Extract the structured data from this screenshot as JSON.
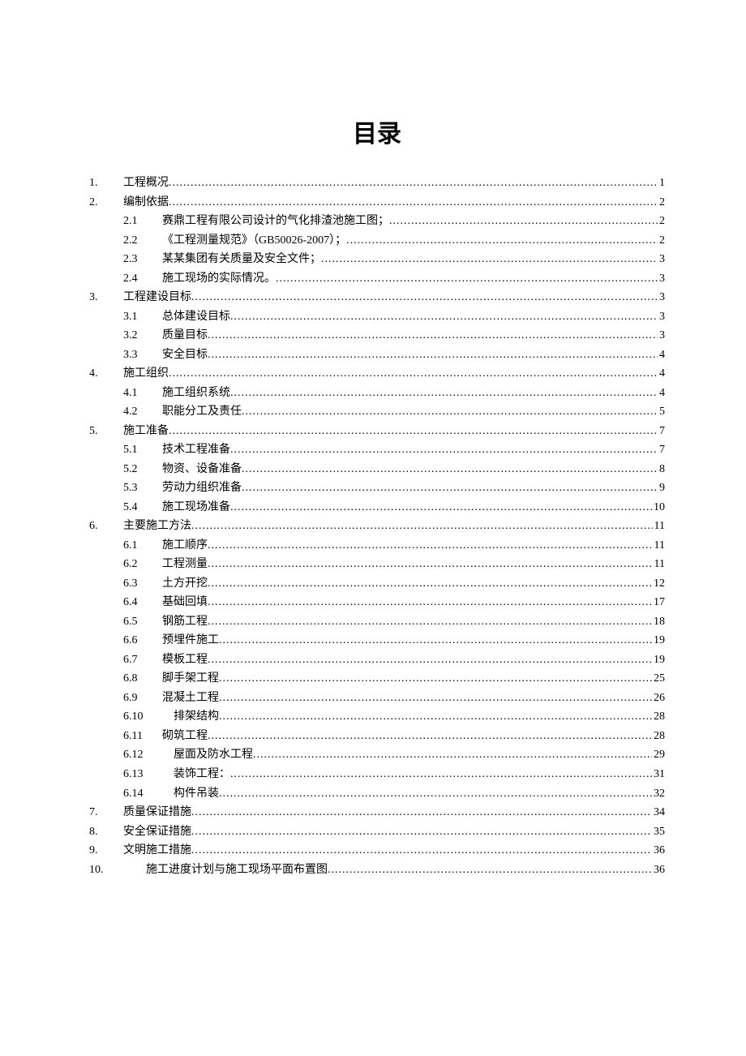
{
  "title": "目录",
  "toc": [
    {
      "level": 1,
      "num": "1.",
      "label": "工程概况",
      "page": "1"
    },
    {
      "level": 1,
      "num": "2.",
      "label": "编制依据",
      "page": "2"
    },
    {
      "level": 2,
      "num": "2.1",
      "label": "赛鼎工程有限公司设计的气化排渣池施工图；",
      "page": "2"
    },
    {
      "level": 2,
      "num": "2.2",
      "label": "《工程测量规范》（GB50026-2007）；",
      "page": "2"
    },
    {
      "level": 2,
      "num": "2.3",
      "label": "某某集团有关质量及安全文件；",
      "page": "3"
    },
    {
      "level": 2,
      "num": "2.4",
      "label": "施工现场的实际情况。",
      "page": "3"
    },
    {
      "level": 1,
      "num": "3.",
      "label": "工程建设目标",
      "page": "3"
    },
    {
      "level": 2,
      "num": "3.1",
      "label": "总体建设目标",
      "page": "3"
    },
    {
      "level": 2,
      "num": "3.2",
      "label": "质量目标",
      "page": "3"
    },
    {
      "level": 2,
      "num": "3.3",
      "label": "安全目标",
      "page": "4"
    },
    {
      "level": 1,
      "num": "4.",
      "label": "施工组织",
      "page": "4"
    },
    {
      "level": 2,
      "num": "4.1",
      "label": "施工组织系统",
      "page": "4"
    },
    {
      "level": 2,
      "num": "4.2",
      "label": "职能分工及责任",
      "page": "5"
    },
    {
      "level": 1,
      "num": "5.",
      "label": "施工准备",
      "page": "7"
    },
    {
      "level": 2,
      "num": "5.1",
      "label": "技术工程准备",
      "page": "7"
    },
    {
      "level": 2,
      "num": "5.2",
      "label": "物资、设备准备",
      "page": "8"
    },
    {
      "level": 2,
      "num": "5.3",
      "label": "劳动力组织准备",
      "page": "9"
    },
    {
      "level": 2,
      "num": "5.4",
      "label": "施工现场准备",
      "page": "10"
    },
    {
      "level": 1,
      "num": "6.",
      "label": "主要施工方法",
      "page": "11"
    },
    {
      "level": 2,
      "num": "6.1",
      "label": "施工顺序",
      "page": "11"
    },
    {
      "level": 2,
      "num": "6.2",
      "label": "工程测量",
      "page": "11"
    },
    {
      "level": 2,
      "num": "6.3",
      "label": "土方开挖",
      "page": "12"
    },
    {
      "level": 2,
      "num": "6.4",
      "label": "基础回填",
      "page": "17"
    },
    {
      "level": 2,
      "num": "6.5",
      "label": "钢筋工程",
      "page": "18"
    },
    {
      "level": 2,
      "num": "6.6",
      "label": "预埋件施工",
      "page": "19"
    },
    {
      "level": 2,
      "num": "6.7",
      "label": "模板工程",
      "page": "19"
    },
    {
      "level": 2,
      "num": "6.8",
      "label": "脚手架工程",
      "page": "25"
    },
    {
      "level": 2,
      "num": "6.9",
      "label": "混凝土工程",
      "page": "26"
    },
    {
      "level": 2,
      "num": "6.10",
      "label": "　排架结构",
      "page": "28"
    },
    {
      "level": 2,
      "num": "6.11",
      "label": "砌筑工程",
      "page": "28"
    },
    {
      "level": 2,
      "num": "6.12",
      "label": "　屋面及防水工程",
      "page": "29"
    },
    {
      "level": 2,
      "num": "6.13",
      "label": "　装饰工程：",
      "page": "31"
    },
    {
      "level": 2,
      "num": "6.14",
      "label": "　构件吊装",
      "page": "32"
    },
    {
      "level": 1,
      "num": "7.",
      "label": "质量保证措施",
      "page": "34"
    },
    {
      "level": 1,
      "num": "8.",
      "label": "安全保证措施",
      "page": "35"
    },
    {
      "level": 1,
      "num": "9.",
      "label": "文明施工措施",
      "page": "36"
    },
    {
      "level": 1,
      "num": "10.",
      "label": "　施工进度计划与施工现场平面布置图",
      "page": "36"
    }
  ]
}
